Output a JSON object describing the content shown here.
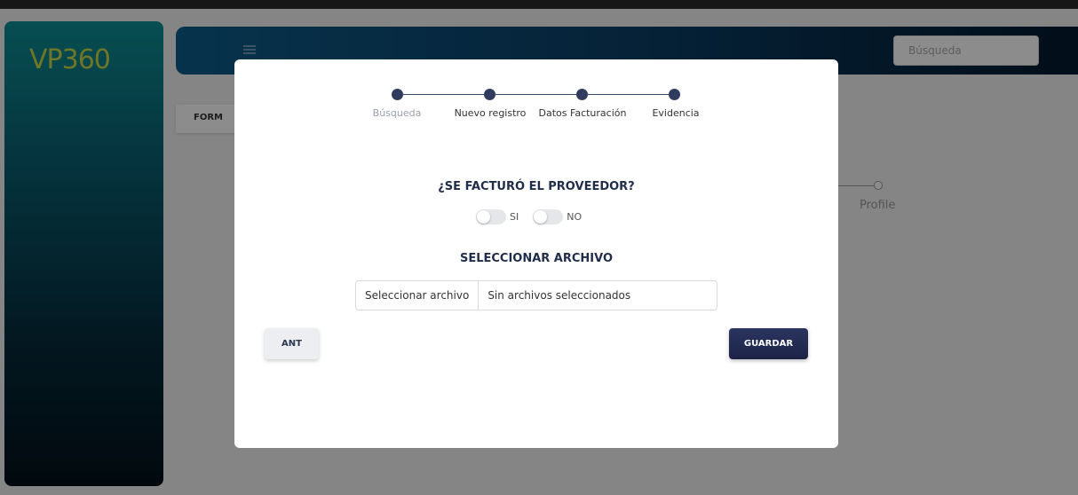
{
  "app": {
    "logo_text": "VP360",
    "search_placeholder": "Búsqueda",
    "form_tab_label": "FORM",
    "bg_step_label": "Profile"
  },
  "modal": {
    "steps": [
      {
        "label": "Búsqueda",
        "state": "muted"
      },
      {
        "label": "Nuevo registro",
        "state": "active"
      },
      {
        "label": "Datos Facturación",
        "state": "active"
      },
      {
        "label": "Evidencia",
        "state": "active"
      }
    ],
    "question_title": "¿SE FACTURÓ EL PROVEEDOR?",
    "toggle_options": [
      {
        "label": "SI",
        "checked": false
      },
      {
        "label": "NO",
        "checked": false
      }
    ],
    "file_section_title": "SELECCIONAR ARCHIVO",
    "file_button_label": "Seleccionar archivo",
    "file_status": "Sin archivos seleccionados",
    "prev_button_label": "ANT",
    "save_button_label": "GUARDAR"
  },
  "colors": {
    "primary": "#2f3c5e",
    "save_button": "#1c2346",
    "sidebar_accent": "#0c8f95",
    "logo": "#c9d84a"
  }
}
